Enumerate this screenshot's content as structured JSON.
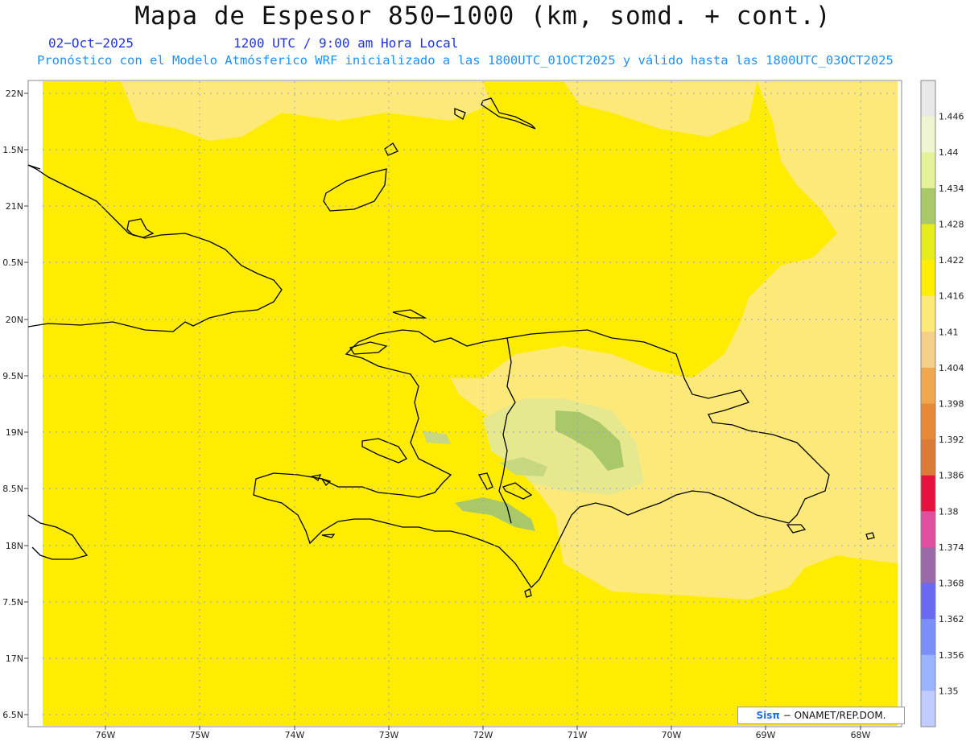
{
  "header": {
    "title": "Mapa de Espesor 850−1000 (km, somd. + cont.)",
    "date": "02−Oct−2025",
    "time": "1200 UTC / 9:00 am Hora Local",
    "subtitle": "Pronóstico con el Modelo Atmósferico WRF inicializado a las 1800UTC_01OCT2025 y válido hasta las  1800UTC_03OCT2025"
  },
  "map": {
    "lat_labels": [
      "22N",
      "1.5N",
      "21N",
      "0.5N",
      "20N",
      "9.5N",
      "19N",
      "8.5N",
      "18N",
      "7.5N",
      "17N",
      "6.5N"
    ],
    "lon_labels": [
      "76W",
      "75W",
      "74W",
      "73W",
      "72W",
      "71W",
      "70W",
      "69W",
      "68W"
    ],
    "colors": {
      "background": "#ffec00",
      "light_zone": "#fde97a",
      "mid_zone": "#d6e69a",
      "dark_zone": "#a8c86a",
      "coast": "#000000",
      "grid": "#8899bb"
    }
  },
  "colorbar": {
    "labels": [
      "1.446",
      "1.44",
      "1.434",
      "1.428",
      "1.422",
      "1.416",
      "1.41",
      "1.404",
      "1.398",
      "1.392",
      "1.386",
      "1.38",
      "1.374",
      "1.368",
      "1.362",
      "1.356",
      "1.35"
    ],
    "colors": [
      "#e8e8e8",
      "#f0f4d0",
      "#e6f29a",
      "#a8c86a",
      "#e6ec1a",
      "#ffee00",
      "#fde97a",
      "#f4cf8a",
      "#f0a850",
      "#e68a3a",
      "#dc7a38",
      "#e8103c",
      "#e050a0",
      "#9a6aa8",
      "#6a6af0",
      "#7a90f8",
      "#9ab4ff",
      "#c0ccff"
    ]
  },
  "credit": {
    "logo": "Sisπ",
    "text": "− ONAMET/REP.DOM."
  }
}
